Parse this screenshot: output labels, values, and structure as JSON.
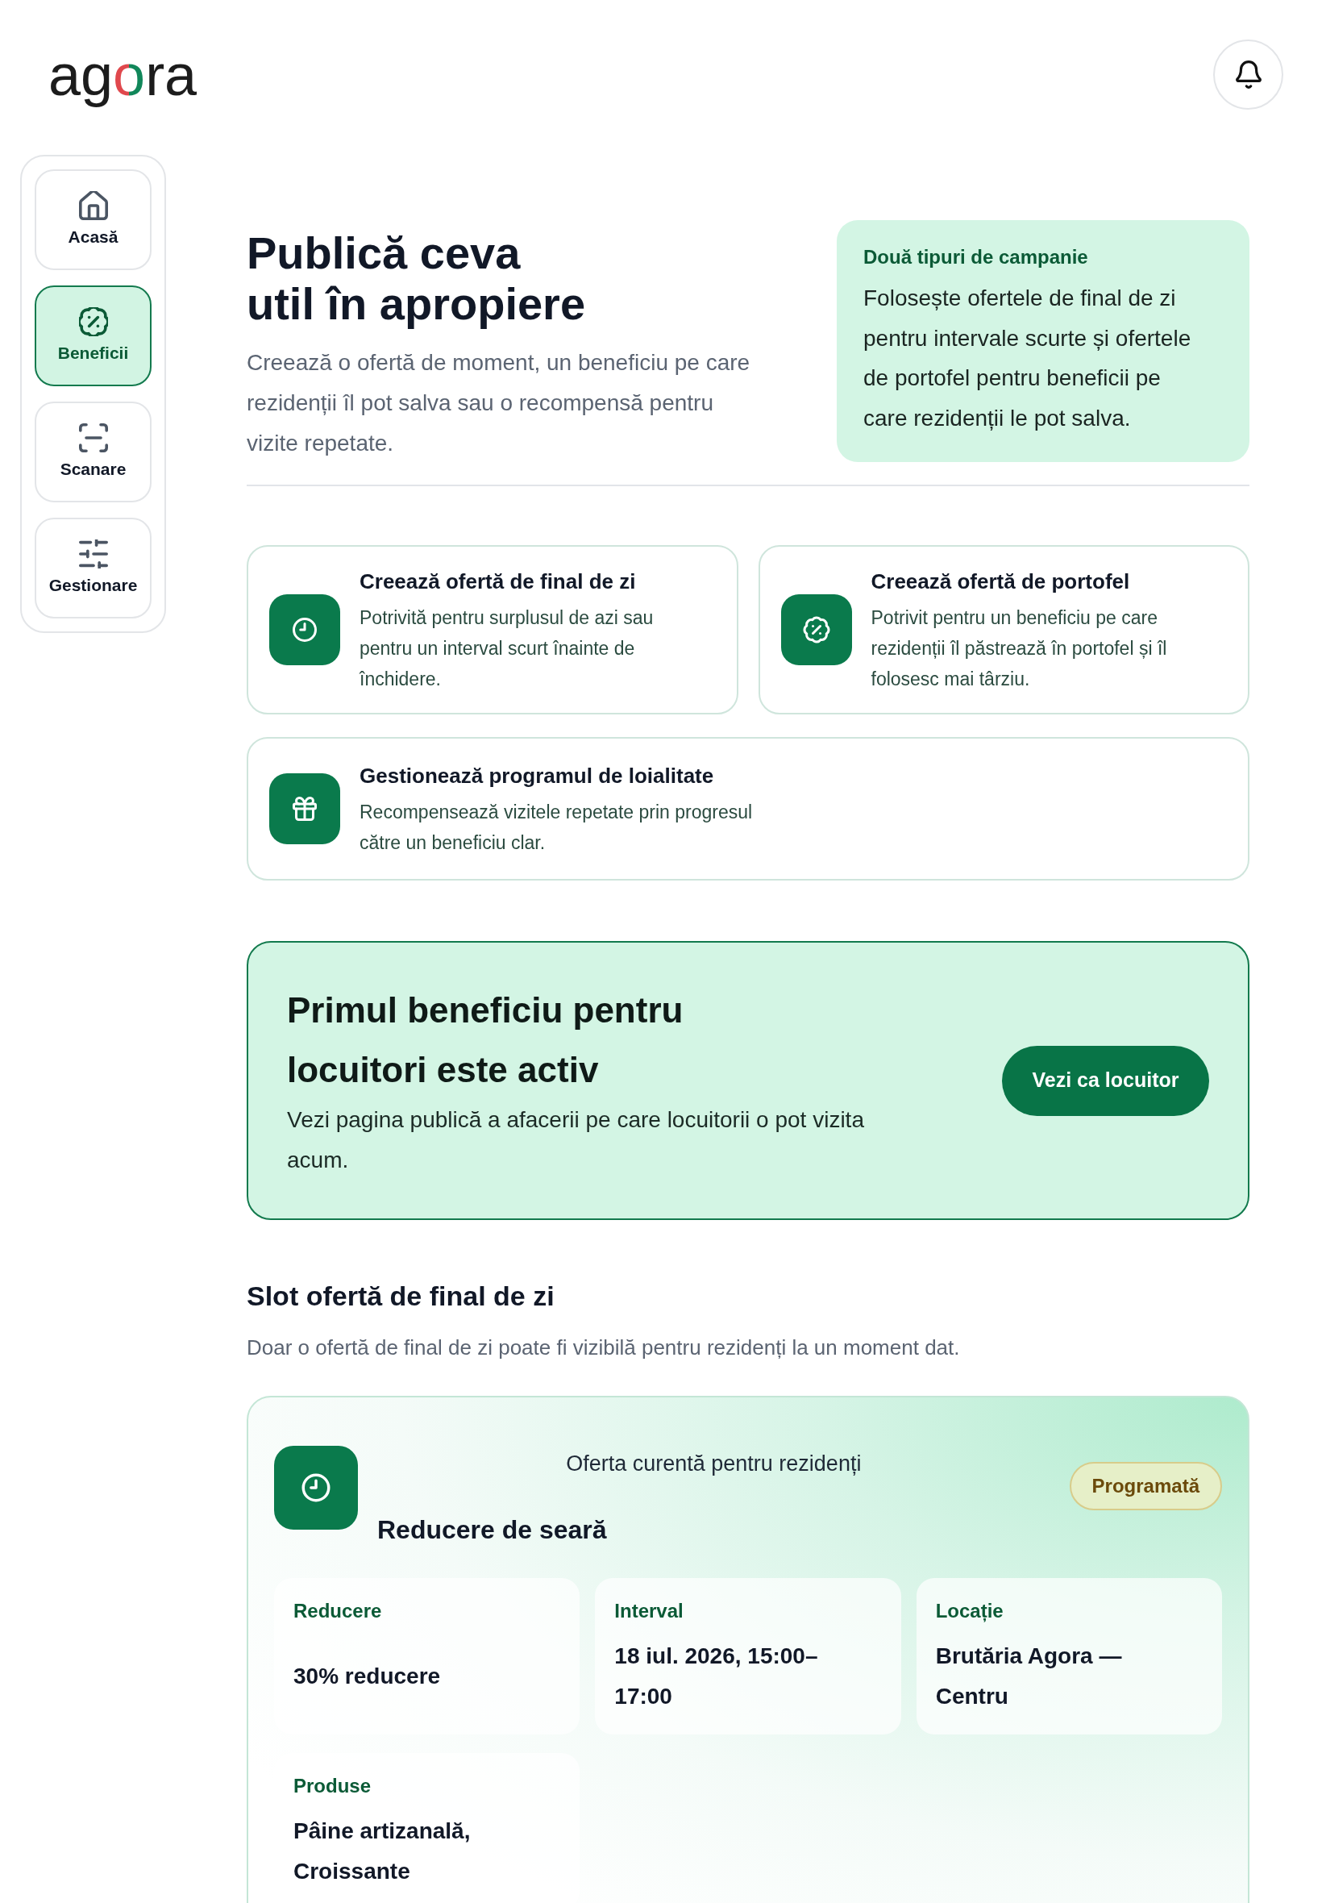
{
  "logo": {
    "text": "agora"
  },
  "sidebar": {
    "items": [
      {
        "label": "Acasă",
        "selected": false
      },
      {
        "label": "Beneficii",
        "selected": true
      },
      {
        "label": "Scanare",
        "selected": false
      },
      {
        "label": "Gestionare",
        "selected": false
      }
    ]
  },
  "intro": {
    "title": "Publică ceva util în apropiere",
    "description": "Creează o ofertă de moment, un beneficiu pe care rezidenții îl pot salva sau o recompensă pentru vizite repetate."
  },
  "info_card": {
    "title": "Două tipuri de campanie",
    "text": "Folosește ofertele de final de zi pentru intervale scurte și ofertele de portofel pentru beneficii pe care rezidenții le pot salva."
  },
  "actions": [
    {
      "title": "Creează ofertă de final de zi",
      "description": "Potrivită pentru surplusul de azi sau pentru un interval scurt înainte de închidere."
    },
    {
      "title": "Creează ofertă de portofel",
      "description": "Potrivit pentru un beneficiu pe care rezidenții îl păstrează în portofel și îl folosesc mai târziu."
    },
    {
      "title": "Gestionează programul de loialitate",
      "description": "Recompensează vizitele repetate prin progresul către un beneficiu clar."
    }
  ],
  "banner": {
    "title": "Primul beneficiu pentru locuitori este activ",
    "text": "Vezi pagina publică a afacerii pe care locuitorii o pot vizita acum.",
    "button": "Vezi ca locuitor"
  },
  "slot_section": {
    "title": "Slot ofertă de final de zi",
    "description": "Doar o ofertă de final de zi poate fi vizibilă pentru rezidenți la un moment dat."
  },
  "current_offer": {
    "label": "Oferta curentă pentru rezidenți",
    "title": "Reducere de seară",
    "status": "Programată",
    "details": [
      {
        "label": "Reducere",
        "value": "30% reducere"
      },
      {
        "label": "Interval",
        "value": "18 iul. 2026, 15:00–17:00"
      },
      {
        "label": "Locație",
        "value": "Brutăria Agora — Centru"
      },
      {
        "label": "Produse",
        "value": "Pâine artizanală, Croissante"
      }
    ]
  }
}
